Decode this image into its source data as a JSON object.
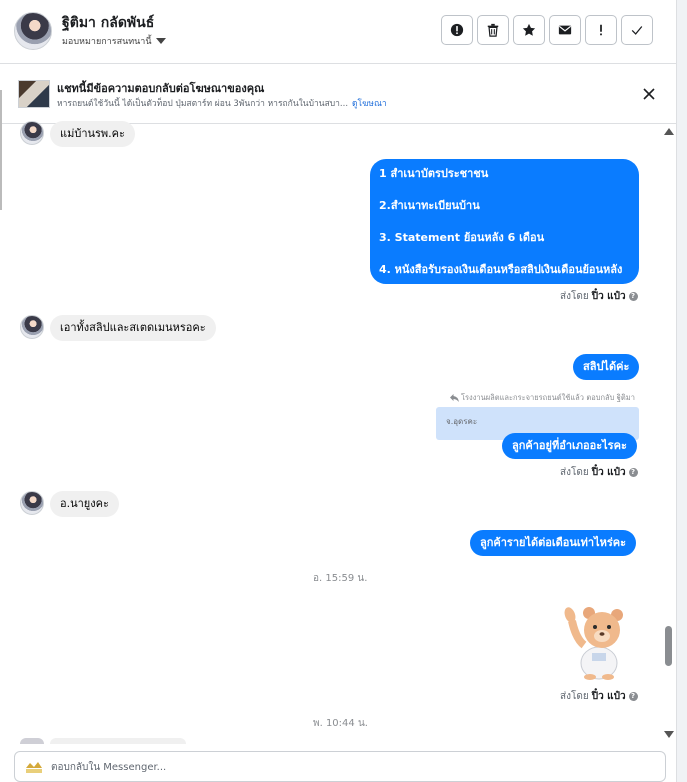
{
  "header": {
    "contact_name": "ฐิติมา กลัดพันธ์",
    "assign_label": "มอบหมายการสนทนานี้",
    "actions": [
      {
        "icon": "exclamation-circle-icon",
        "name": "mark-spam-button"
      },
      {
        "icon": "trash-icon",
        "name": "delete-button"
      },
      {
        "icon": "star-icon",
        "name": "star-button"
      },
      {
        "icon": "envelope-icon",
        "name": "mark-unread-button"
      },
      {
        "icon": "exclamation-icon",
        "name": "follow-up-button"
      },
      {
        "icon": "check-icon",
        "name": "mark-done-button"
      }
    ]
  },
  "ad_banner": {
    "title": "แชทนี้มีข้อความตอบกลับต่อโฆษณาของคุณ",
    "subtitle": "หารถยนต์ใช้วันนี้ ได้เป็นตัวท็อป ปุ่มสตาร์ท ผ่อน 3พันกว่า หารถกันในบ้านสบา...",
    "link": "ดูโฆษณา"
  },
  "messages": {
    "m1": "แม่บ้านรพ.คะ",
    "m2_lines": [
      "1 สำเนาบัตรประชาชน",
      "2.สำเนาทะเบียนบ้าน",
      " 3. Statement ย้อนหลัง 6 เดือน",
      "4. หนังสือรับรองเงินเดือนหรือสลิปเงินเดือนย้อนหลัง"
    ],
    "m3": "เอาทั้งสลิปและสเตดเมนหรอคะ",
    "m4": "สลิปได้ค่ะ",
    "reply_header": "โรงงานผลิตและกระจายรถยนต์ใช้แล้ว ตอบกลับ ฐิติมา",
    "quoted": "จ.อุดรคะ",
    "m5": "ลูกค้าอยู่ที่อำเภออะไรคะ",
    "m6": "อ.นายูงคะ",
    "m7": "ลูกค้ารายได้ต่อเดือนเท่าไหร่คะ",
    "ts1": "อ. 15:59 น.",
    "ts2": "พ. 10:44 น."
  },
  "sent_by": {
    "prefix": "ส่งโดย",
    "agent": "ปิ๋ว แป๋ว",
    "help": "?"
  },
  "composer": {
    "placeholder": "ตอบกลับใน Messenger..."
  },
  "colors": {
    "outgoing": "#0a7cff",
    "incoming": "#f0f0f0",
    "link": "#216fdb",
    "quoted_bg": "#cfe2fb"
  }
}
